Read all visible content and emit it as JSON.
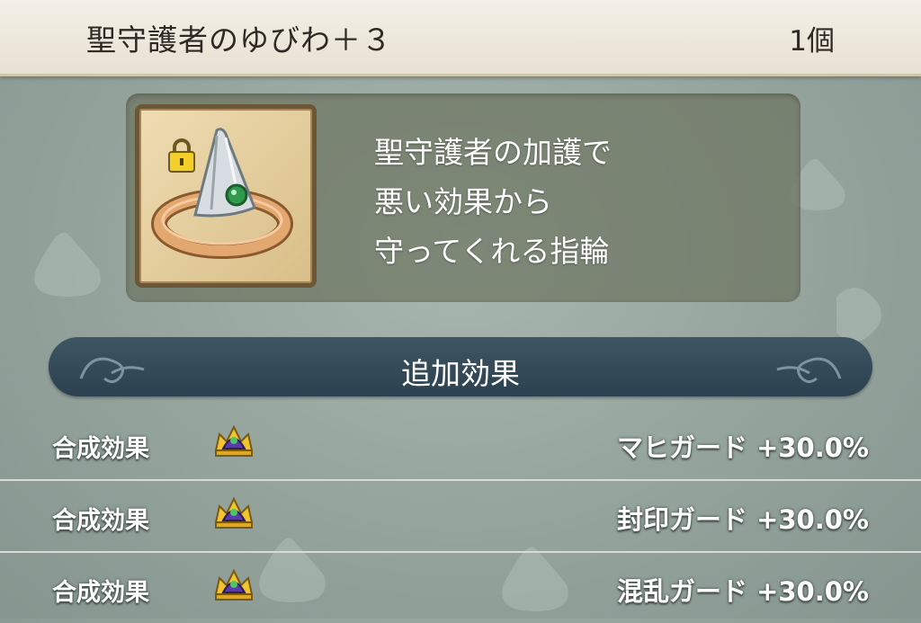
{
  "header": {
    "item_name": "聖守護者のゆびわ＋３",
    "item_count": "1個"
  },
  "item": {
    "icon": "ring-icon",
    "lock_icon": "padlock-icon",
    "description_lines": [
      "聖守護者の加護で",
      "悪い効果から",
      "守ってくれる指輪"
    ]
  },
  "section": {
    "title": "追加効果"
  },
  "effects": [
    {
      "label": "合成効果",
      "icon": "crown-icon",
      "value": "マヒガード +30.0%"
    },
    {
      "label": "合成効果",
      "icon": "crown-icon",
      "value": "封印ガード +30.0%"
    },
    {
      "label": "合成効果",
      "icon": "crown-icon",
      "value": "混乱ガード +30.0%"
    }
  ],
  "colors": {
    "header_bg": "#ece7da",
    "background": "#9aa8a2",
    "banner": "#34495a",
    "panel": "#6c7460"
  }
}
